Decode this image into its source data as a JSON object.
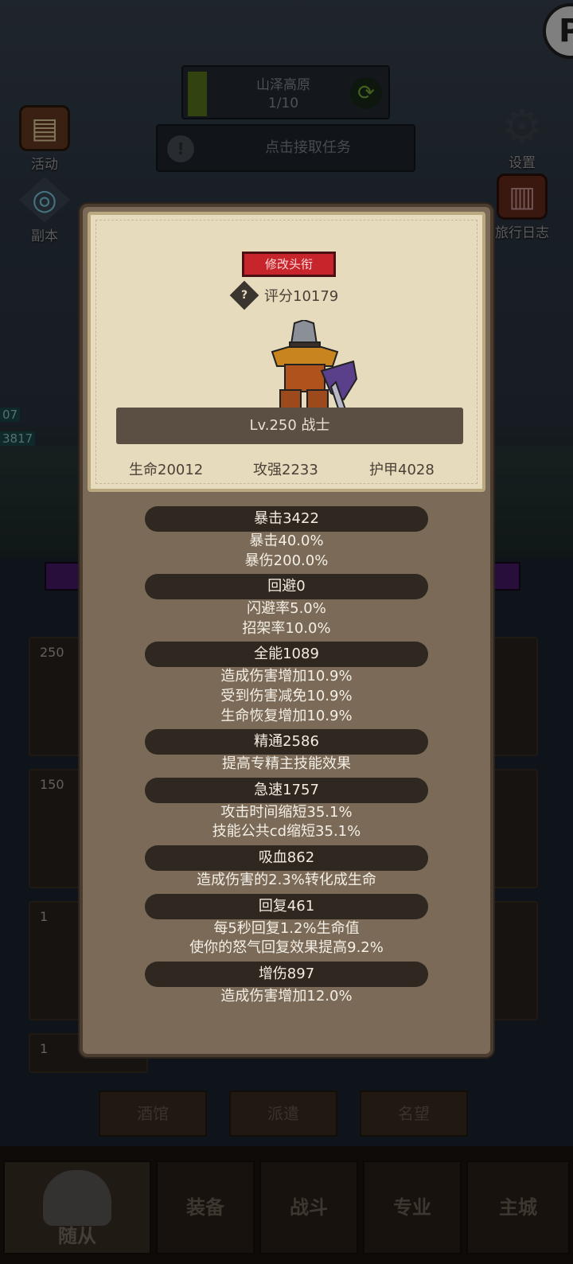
{
  "colors": {
    "panel": "#7a6a57",
    "card": "#e7dbbe",
    "stat_header": "#2f2820",
    "rename_button": "#c8242c",
    "zone_progress": "#5c7a1e"
  },
  "zone": {
    "name": "山泽高原",
    "progress": "1/10",
    "refresh_icon": "refresh-icon"
  },
  "quest": {
    "label": "点击接取任务",
    "icon": "alert-icon"
  },
  "side_left": [
    {
      "label": "活动",
      "icon": "calendar-icon"
    },
    {
      "label": "副本",
      "icon": "portal-icon"
    }
  ],
  "side_right": [
    {
      "label": "设置",
      "icon": "gear-icon"
    },
    {
      "label": "旅行日志",
      "icon": "journal-icon"
    }
  ],
  "hp_tags": [
    "07",
    "3817"
  ],
  "slots": [
    "250",
    "150",
    "1",
    "1"
  ],
  "bottom_buttons": [
    "酒馆",
    "派遣",
    "名望"
  ],
  "nav": [
    "随从",
    "装备",
    "战斗",
    "专业",
    "主城"
  ],
  "character": {
    "rename_label": "修改头衔",
    "score": "评分10179",
    "level_class": "Lv.250 战士",
    "hp": "生命20012",
    "attack": "攻强2233",
    "armor": "护甲4028"
  },
  "stats": [
    {
      "title": "暴击3422",
      "lines": [
        "暴击40.0%",
        "暴伤200.0%"
      ]
    },
    {
      "title": "回避0",
      "lines": [
        "闪避率5.0%",
        "招架率10.0%"
      ]
    },
    {
      "title": "全能1089",
      "lines": [
        "造成伤害增加10.9%",
        "受到伤害减免10.9%",
        "生命恢复增加10.9%"
      ]
    },
    {
      "title": "精通2586",
      "lines": [
        "提高专精主技能效果"
      ]
    },
    {
      "title": "急速1757",
      "lines": [
        "攻击时间缩短35.1%",
        "技能公共cd缩短35.1%"
      ]
    },
    {
      "title": "吸血862",
      "lines": [
        "造成伤害的2.3%转化成生命"
      ]
    },
    {
      "title": "回复461",
      "lines": [
        "每5秒回复1.2%生命值",
        "使你的怒气回复效果提高9.2%"
      ]
    },
    {
      "title": "增伤897",
      "lines": [
        "造成伤害增加12.0%"
      ]
    }
  ]
}
